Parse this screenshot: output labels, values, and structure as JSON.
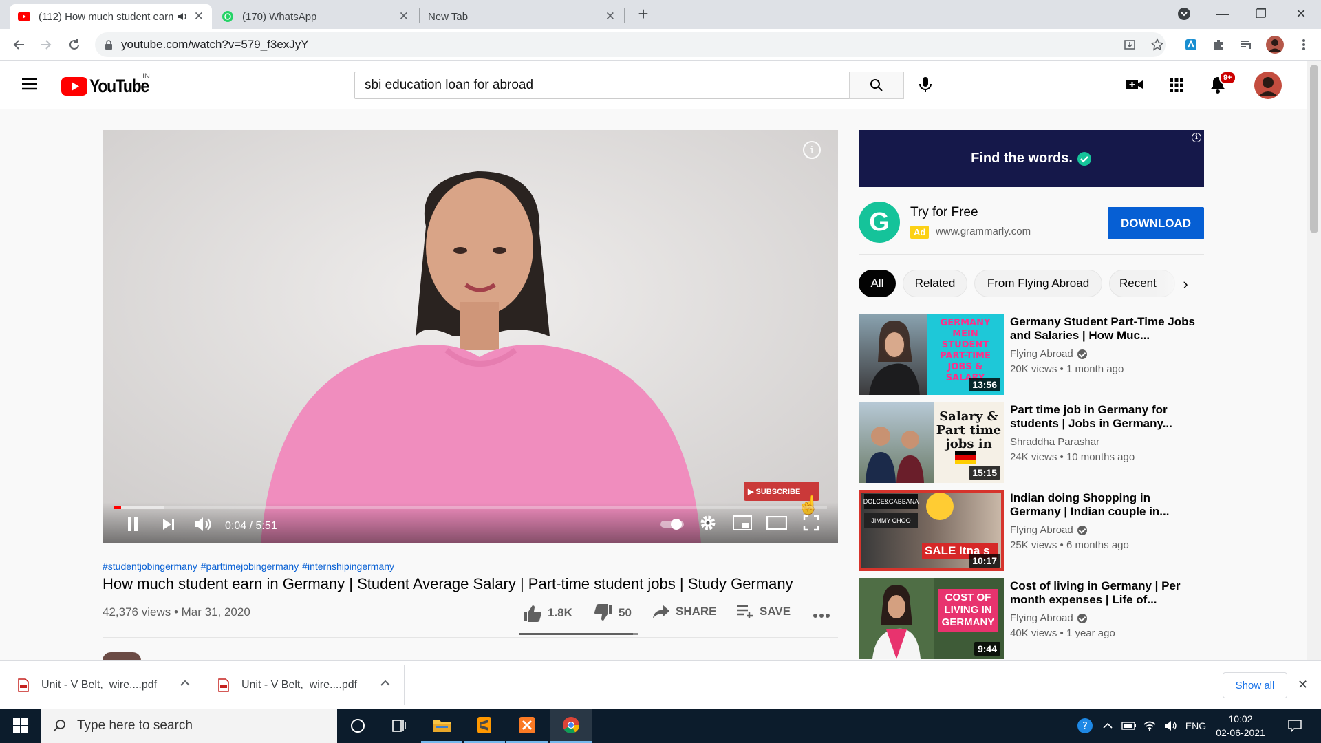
{
  "browser": {
    "tabs": [
      {
        "title": "(112) How much student earn",
        "active": true
      },
      {
        "title": "(170) WhatsApp",
        "active": false
      },
      {
        "title": "New Tab",
        "active": false
      }
    ],
    "url": "youtube.com/watch?v=579_f3exJyY"
  },
  "youtube": {
    "logo_text": "YouTube",
    "region": "IN",
    "search_query": "sbi education loan for abroad",
    "notification_count": "9+"
  },
  "player": {
    "time": "0:04 / 5:51",
    "progress_fraction": 0.011,
    "buffer_fraction": 0.07
  },
  "video": {
    "hashtags": [
      "#studentjobingermany",
      "#parttimejobingermany",
      "#internshipingermany"
    ],
    "title": "How much student earn in Germany | Student Average Salary | Part-time student jobs | Study Germany",
    "views_date": "42,376 views • Mar 31, 2020",
    "likes": "1.8K",
    "dislikes": "50",
    "share_label": "SHARE",
    "save_label": "SAVE",
    "like_fraction": 0.96
  },
  "ad": {
    "banner_text": "Find the words.",
    "headline": "Try for Free",
    "badge": "Ad",
    "domain": "www.grammarly.com",
    "cta": "DOWNLOAD",
    "logo_letter": "G"
  },
  "chips": [
    "All",
    "Related",
    "From Flying Abroad",
    "Recent"
  ],
  "recommendations": [
    {
      "title": "Germany Student Part-Time Jobs and Salaries | How Muc...",
      "channel": "Flying Abroad",
      "verified": true,
      "meta": "20K views • 1 month ago",
      "duration": "13:56",
      "thumb_text": "GERMANY MEIN STUDENT PART-TIME JOBS & SALARY",
      "thumb_color": "#1ec8d8"
    },
    {
      "title": "Part time job in Germany for students | Jobs in Germany...",
      "channel": "Shraddha Parashar",
      "verified": false,
      "meta": "24K views • 10 months ago",
      "duration": "15:15",
      "thumb_text": "Salary & Part time jobs in",
      "thumb_color": "#f5f0e6"
    },
    {
      "title": "Indian doing Shopping in Germany | Indian couple in...",
      "channel": "Flying Abroad",
      "verified": true,
      "meta": "25K views • 6 months ago",
      "duration": "10:17",
      "thumb_text": "SALE Itna s",
      "thumb_color": "#d6342c"
    },
    {
      "title": "Cost of living in Germany | Per month expenses | Life of...",
      "channel": "Flying Abroad",
      "verified": true,
      "meta": "40K views • 1 year ago",
      "duration": "9:44",
      "thumb_text": "COST OF LIVING IN GERMANY",
      "thumb_color": "#e8336e"
    }
  ],
  "downloads": [
    {
      "name": "Unit - V Belt,  wire....pdf"
    },
    {
      "name": "Unit - V Belt,  wire....pdf"
    }
  ],
  "downloads_show_all": "Show all",
  "taskbar": {
    "search_placeholder": "Type here to search",
    "lang": "ENG",
    "time": "10:02",
    "date": "02-06-2021"
  }
}
